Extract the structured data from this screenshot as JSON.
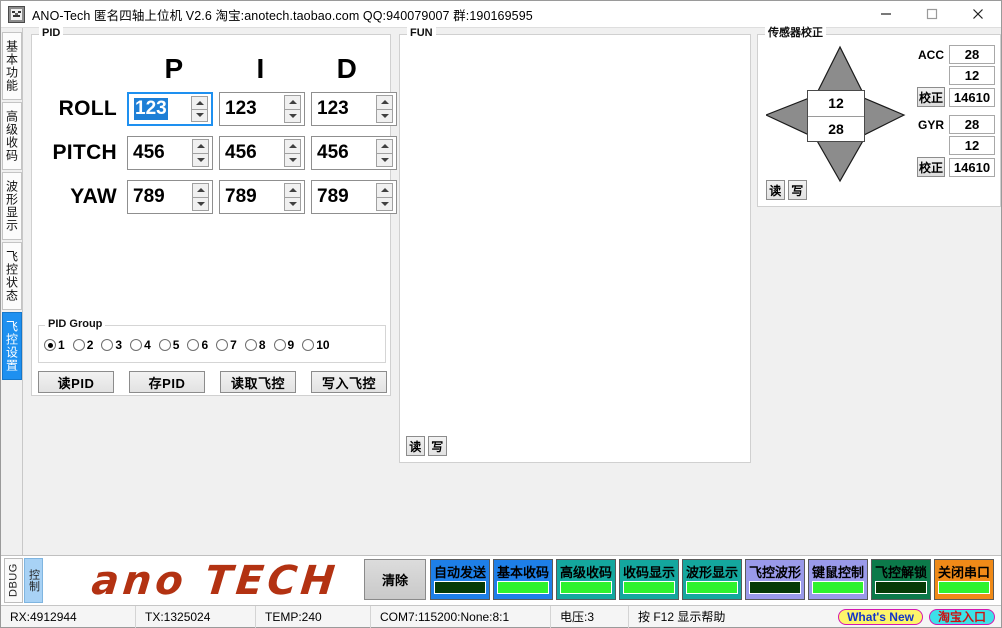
{
  "window": {
    "icon": "app-icon",
    "title": "ANO-Tech  匿名四轴上位机   V2.6  淘宝:anotech.taobao.com  QQ:940079007  群:190169595",
    "minimize": "minimize-icon",
    "maximize": "maximize-icon",
    "close": "close-icon"
  },
  "sidebar": {
    "tabs": [
      {
        "label": "基本功能",
        "selected": false
      },
      {
        "label": "高级收码",
        "selected": false
      },
      {
        "label": "波形显示",
        "selected": false
      },
      {
        "label": "飞控状态",
        "selected": false
      },
      {
        "label": "飞控设置",
        "selected": true
      }
    ]
  },
  "pid": {
    "title": "PID",
    "columns": [
      "P",
      "I",
      "D"
    ],
    "rows": [
      {
        "label": "ROLL",
        "values": [
          "123",
          "123",
          "123"
        ]
      },
      {
        "label": "PITCH",
        "values": [
          "456",
          "456",
          "456"
        ]
      },
      {
        "label": "YAW",
        "values": [
          "789",
          "789",
          "789"
        ]
      }
    ],
    "focused_cell": {
      "row": 0,
      "col": 0
    },
    "group": {
      "title": "PID Group",
      "options": [
        "1",
        "2",
        "3",
        "4",
        "5",
        "6",
        "7",
        "8",
        "9",
        "10"
      ],
      "selected": "1"
    },
    "buttons": [
      "读PID",
      "存PID",
      "读取飞控",
      "写入飞控"
    ]
  },
  "fun": {
    "title": "FUN",
    "buttons": [
      "读",
      "写"
    ]
  },
  "sensor": {
    "title": "传感器校正",
    "center_values": [
      "12",
      "28"
    ],
    "acc": {
      "label": "ACC",
      "v1": "28",
      "v2": "12",
      "v3": "14610",
      "cal_label": "校正"
    },
    "gyr": {
      "label": "GYR",
      "v1": "28",
      "v2": "12",
      "v3": "14610",
      "cal_label": "校正"
    },
    "buttons": [
      "读",
      "写"
    ]
  },
  "brand": {
    "tabs": [
      {
        "label": "DBUG",
        "selected": false
      },
      {
        "label": "控制",
        "selected": true
      }
    ],
    "logo": "ano TECH",
    "logo_color": "#b33212",
    "clear_label": "清除",
    "toggles": [
      {
        "label": "自动发送",
        "bg": "#1e7fe8",
        "indicator": "#063a06"
      },
      {
        "label": "基本收码",
        "bg": "#1e7fe8",
        "indicator": "#2ef22e"
      },
      {
        "label": "高级收码",
        "bg": "#14a79e",
        "indicator": "#2ef22e"
      },
      {
        "label": "收码显示",
        "bg": "#14a79e",
        "indicator": "#2ef22e"
      },
      {
        "label": "波形显示",
        "bg": "#14a79e",
        "indicator": "#2ef22e"
      },
      {
        "label": "飞控波形",
        "bg": "#9a9aea",
        "indicator": "#063a06"
      },
      {
        "label": "键鼠控制",
        "bg": "#9a9aea",
        "indicator": "#2ef22e"
      },
      {
        "label": "飞控解锁",
        "bg": "#0c7a4a",
        "indicator": "#063a06"
      },
      {
        "label": "关闭串口",
        "bg": "#f08a18",
        "indicator": "#2ef22e"
      }
    ]
  },
  "status": {
    "rx": "RX:4912944",
    "tx": "TX:1325024",
    "temp": "TEMP:240",
    "com": "COM7:115200:None:8:1",
    "voltage": "电压:3",
    "help": "按 F12 显示帮助",
    "whats_new": "What's New",
    "taobao": "淘宝入口"
  }
}
